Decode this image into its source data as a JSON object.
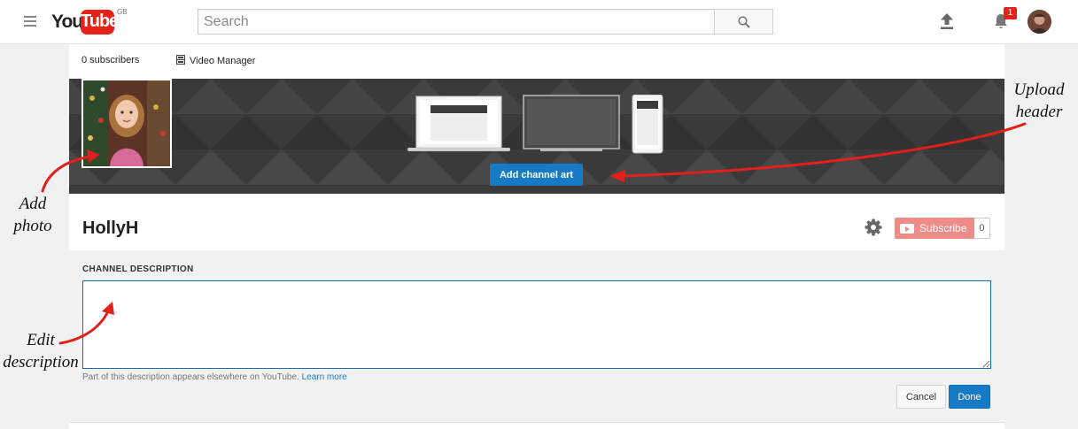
{
  "header": {
    "logo_you": "You",
    "logo_tube": "Tube",
    "logo_region": "GB",
    "search_placeholder": "Search",
    "notification_count": "1"
  },
  "channel": {
    "subscribers": "0 subscribers",
    "video_manager": "Video Manager",
    "add_channel_art": "Add channel art",
    "name": "HollyH",
    "subscribe_label": "Subscribe",
    "subscribe_count": "0"
  },
  "description": {
    "label": "CHANNEL DESCRIPTION",
    "value": "",
    "hint": "Part of this description appears elsewhere on YouTube.",
    "learn_more": "Learn more",
    "cancel": "Cancel",
    "done": "Done"
  },
  "annotations": {
    "upload_header": [
      "Upload",
      "header"
    ],
    "add_photo": [
      "Add",
      "photo"
    ],
    "edit_description": [
      "Edit",
      "description"
    ]
  },
  "colors": {
    "accent_blue": "#167ac6",
    "youtube_red": "#e62117",
    "annotation_red": "#e0201b",
    "subscribe_disabled": "#ee8c8a"
  },
  "icons": [
    "menu-icon",
    "search-icon",
    "upload-icon",
    "bell-icon",
    "video-manager-icon",
    "gear-icon",
    "play-icon"
  ]
}
